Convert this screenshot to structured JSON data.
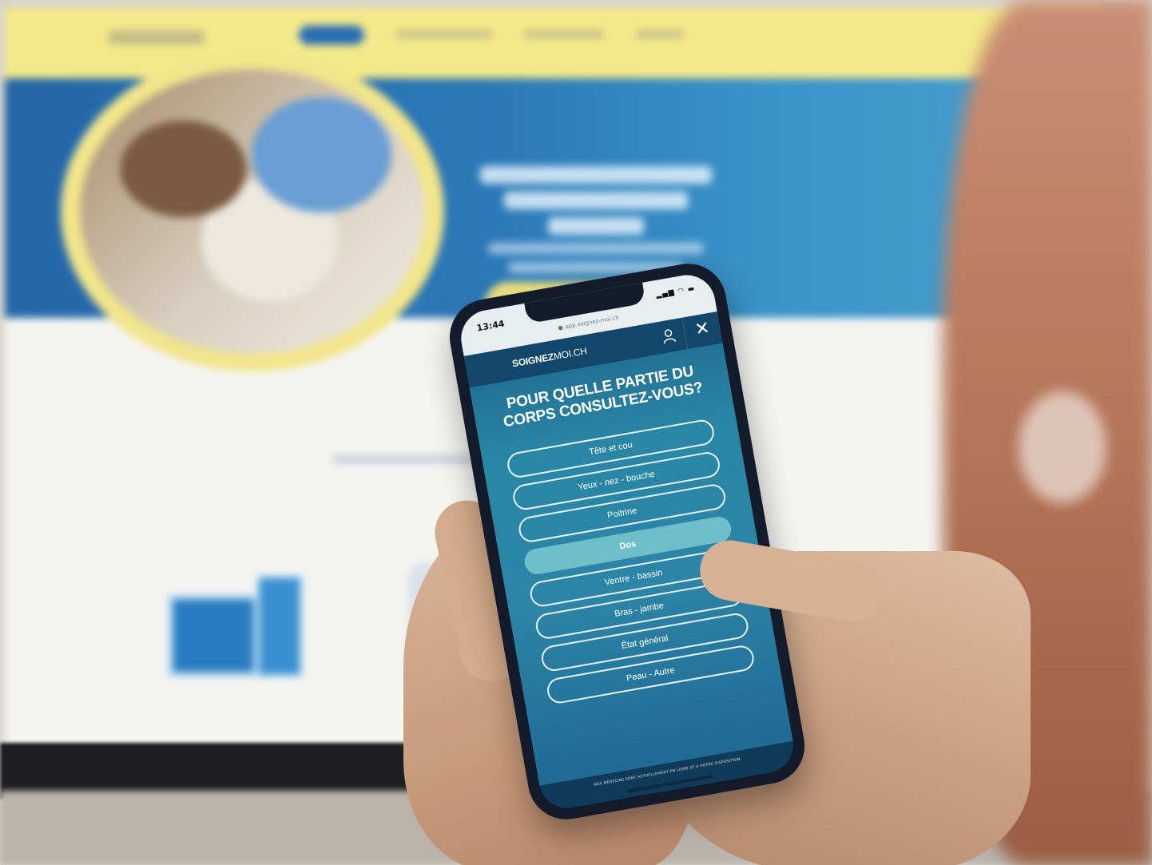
{
  "phone": {
    "status": {
      "time": "13:44",
      "url": "app.soignez-moi.ch"
    },
    "app": {
      "brand_bold": "SOIGNEZ",
      "brand_light": "MOI.CH",
      "close_label": "✕"
    },
    "question": "POUR QUELLE PARTIE DU CORPS CONSULTEZ-VOUS?",
    "options": [
      {
        "label": "Tête et cou",
        "selected": false
      },
      {
        "label": "Yeux - nez - bouche",
        "selected": false
      },
      {
        "label": "Poitrine",
        "selected": false
      },
      {
        "label": "Dos",
        "selected": true
      },
      {
        "label": "Ventre - bassin",
        "selected": false
      },
      {
        "label": "Bras - jambe",
        "selected": false
      },
      {
        "label": "État général",
        "selected": false
      },
      {
        "label": "Peau - Autre",
        "selected": false
      }
    ],
    "footer": "NOS MÉDECINS SONT ACTUELLEMENT EN LIGNE ET À VOTRE DISPOSITION."
  },
  "colors": {
    "screen_teal": "#2a86a5",
    "appbar_navy": "#12476b",
    "selected_option": "#6ebfc9",
    "monitor_yellow": "#f3e98a",
    "monitor_blue": "#2466a8"
  }
}
